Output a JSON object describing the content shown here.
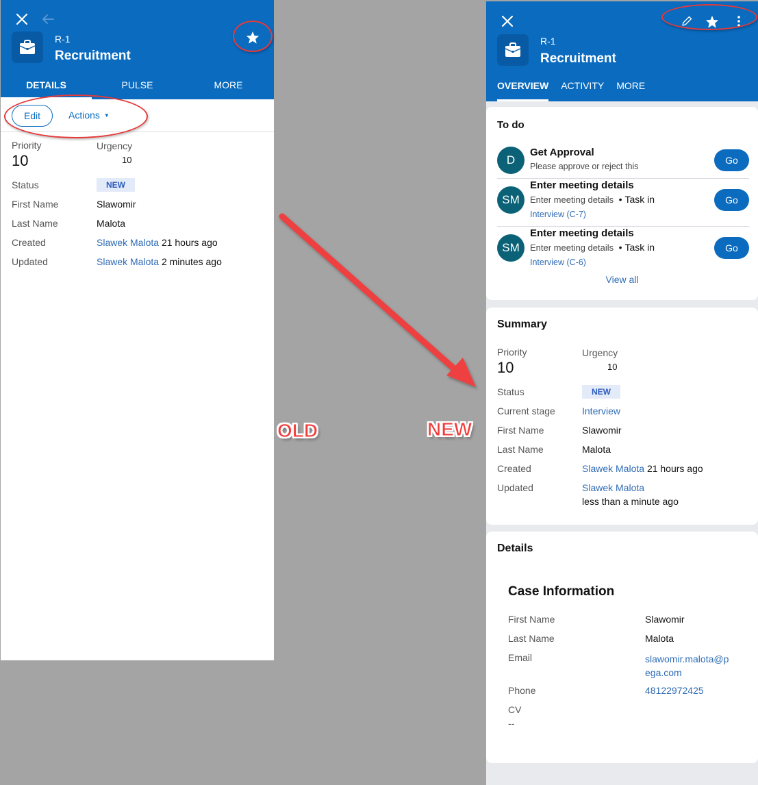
{
  "old": {
    "tag": "OLD",
    "header": {
      "case_id": "R-1",
      "case_title": "Recruitment",
      "icons": [
        "close-icon",
        "back-arrow-icon",
        "briefcase-icon",
        "star-icon"
      ]
    },
    "tabs": [
      {
        "label": "DETAILS",
        "active": true
      },
      {
        "label": "PULSE",
        "active": false
      },
      {
        "label": "MORE",
        "active": false
      }
    ],
    "toolbar": {
      "edit_label": "Edit",
      "actions_label": "Actions"
    },
    "fields": {
      "priority_label": "Priority",
      "priority_value": "10",
      "urgency_label": "Urgency",
      "urgency_value": "10",
      "status_label": "Status",
      "status_value": "NEW",
      "first_name_label": "First Name",
      "first_name_value": "Slawomir",
      "last_name_label": "Last Name",
      "last_name_value": "Malota",
      "created_label": "Created",
      "created_by": "Slawek Malota",
      "created_when": "21 hours ago",
      "updated_label": "Updated",
      "updated_by": "Slawek Malota",
      "updated_when": "2 minutes ago"
    }
  },
  "new": {
    "tag": "NEW",
    "header": {
      "case_id": "R-1",
      "case_title": "Recruitment",
      "icons": [
        "close-icon",
        "pencil-icon",
        "star-icon",
        "more-vertical-icon",
        "briefcase-icon"
      ]
    },
    "tabs": [
      {
        "label": "OVERVIEW",
        "active": true
      },
      {
        "label": "ACTIVITY",
        "active": false
      },
      {
        "label": "MORE",
        "active": false
      }
    ],
    "todo": {
      "title": "To do",
      "items": [
        {
          "avatar": "D",
          "title": "Get Approval",
          "subtitle": "Please approve or reject this",
          "task_in": "",
          "link": "",
          "button": "Go"
        },
        {
          "avatar": "SM",
          "title": "Enter meeting details",
          "subtitle": "Enter meeting details",
          "task_in": "Task in",
          "link": "Interview (C-7)",
          "button": "Go"
        },
        {
          "avatar": "SM",
          "title": "Enter meeting details",
          "subtitle": "Enter meeting details",
          "task_in": "Task in",
          "link": "Interview (C-6)",
          "button": "Go"
        }
      ],
      "view_all": "View all"
    },
    "summary": {
      "title": "Summary",
      "priority_label": "Priority",
      "priority_value": "10",
      "urgency_label": "Urgency",
      "urgency_value": "10",
      "status_label": "Status",
      "status_value": "NEW",
      "stage_label": "Current stage",
      "stage_value": "Interview",
      "first_name_label": "First Name",
      "first_name_value": "Slawomir",
      "last_name_label": "Last Name",
      "last_name_value": "Malota",
      "created_label": "Created",
      "created_by": "Slawek Malota",
      "created_when": "21 hours ago",
      "updated_label": "Updated",
      "updated_by": "Slawek Malota",
      "updated_when": "less than a minute ago"
    },
    "details": {
      "title": "Details",
      "section_title": "Case Information",
      "first_name_label": "First Name",
      "first_name_value": "Slawomir",
      "last_name_label": "Last Name",
      "last_name_value": "Malota",
      "email_label": "Email",
      "email_value_line1": "slawomir.malota@p",
      "email_value_line2": "ega.com",
      "phone_label": "Phone",
      "phone_value": "48122972425",
      "cv_label": "CV",
      "cv_value": "--"
    }
  },
  "colors": {
    "header_blue": "#0a6bbf",
    "link_blue": "#2f6cb5",
    "avatar_teal": "#0b6276",
    "badge_bg": "#e4ebf8",
    "annotation_red": "#e53b3b",
    "background_gray": "#a4a4a4"
  }
}
